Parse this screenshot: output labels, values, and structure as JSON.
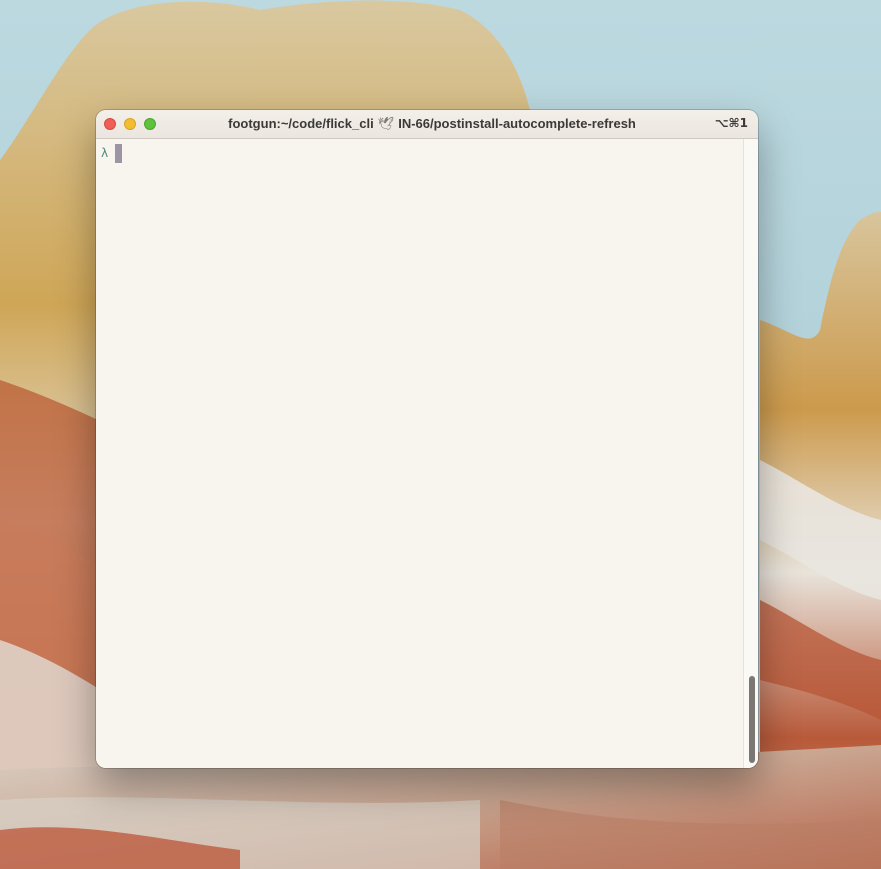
{
  "window": {
    "title_prefix": "footgun:~/code/flick_cli",
    "title_icon": "dove-icon",
    "title_icon_glyph": "🕊",
    "title_branch": "IN-66/postinstall-autocomplete-refresh",
    "shortcut": "⌥⌘1"
  },
  "terminal": {
    "prompt_symbol": "λ",
    "input": ""
  },
  "colors": {
    "background": "#f8f4ee",
    "prompt": "#4f8a7c",
    "cursor": "#9e95a4",
    "close": "#ee5f57",
    "minimize": "#f4bd2f",
    "zoom": "#5fc23d"
  },
  "scrollbar": {
    "position": 1.0
  }
}
